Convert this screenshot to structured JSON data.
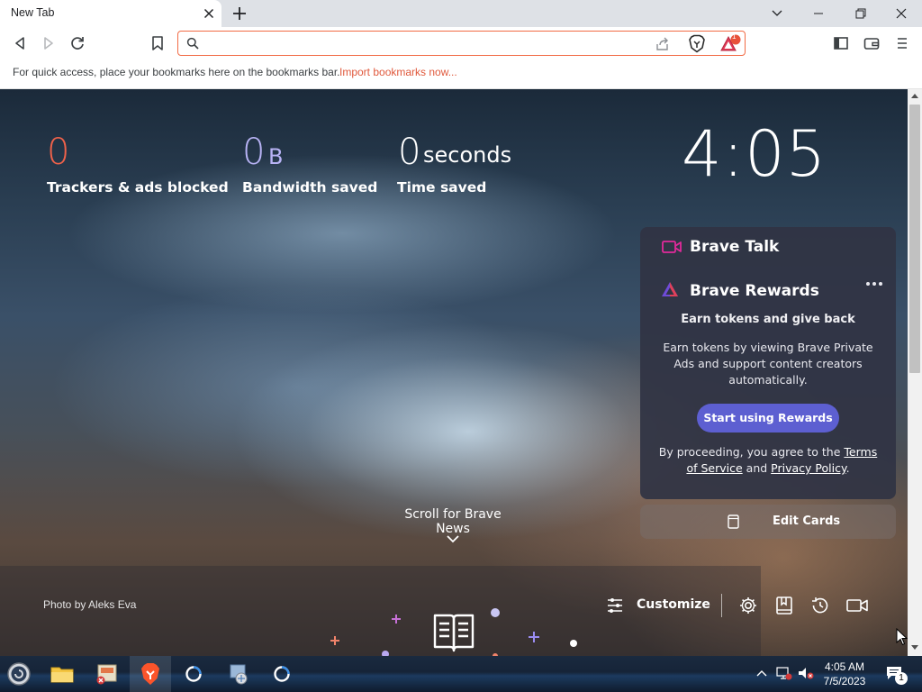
{
  "browser": {
    "tab_title": "New Tab",
    "omnibox_value": "",
    "omnibox_placeholder": "",
    "rewards_badge": "1"
  },
  "bookmarks_bar": {
    "hint": "For quick access, place your bookmarks here on the bookmarks bar.",
    "import_link": "Import bookmarks now..."
  },
  "stats": {
    "trackers": {
      "value": "0",
      "label": "Trackers & ads blocked"
    },
    "bandwidth": {
      "value": "0",
      "unit": "B",
      "label": "Bandwidth saved"
    },
    "time": {
      "value": "0",
      "unit": "seconds",
      "label": "Time saved"
    }
  },
  "clock": "4:05",
  "cards": {
    "talk_title": "Brave Talk",
    "rewards_title": "Brave Rewards",
    "rewards_subtitle": "Earn tokens and give back",
    "rewards_description": "Earn tokens by viewing Brave Private Ads and support content creators automatically.",
    "rewards_button": "Start using Rewards",
    "legal_prefix": "By proceeding, you agree to the",
    "legal_terms": "Terms of Service",
    "legal_and": "and",
    "legal_privacy": "Privacy Policy",
    "legal_suffix": ".",
    "edit_cards": "Edit Cards"
  },
  "news": {
    "scroll_label": "Scroll for Brave News"
  },
  "photo_credit": "Photo by Aleks Eva",
  "bottom_bar": {
    "customize": "Customize"
  },
  "taskbar": {
    "time": "4:05 AM",
    "date": "7/5/2023",
    "notification_count": "1"
  },
  "colors": {
    "brave_orange": "#f26b45",
    "trackers_value": "#f0624a",
    "bandwidth_value": "#b8b3f5",
    "rewards_button": "#5d5fd1",
    "talk_icon": "#e12a9a"
  },
  "icons": [
    "back-icon",
    "forward-icon",
    "reload-icon",
    "bookmark-icon",
    "search-icon",
    "share-icon",
    "brave-shield-icon",
    "brave-rewards-icon",
    "sidebar-icon",
    "wallet-icon",
    "menu-icon",
    "video-camera-icon",
    "more-icon",
    "edit-cards-icon",
    "chevron-down-icon",
    "sliders-icon",
    "gear-icon",
    "bookmarks-icon",
    "history-icon",
    "brave-news-icon"
  ]
}
